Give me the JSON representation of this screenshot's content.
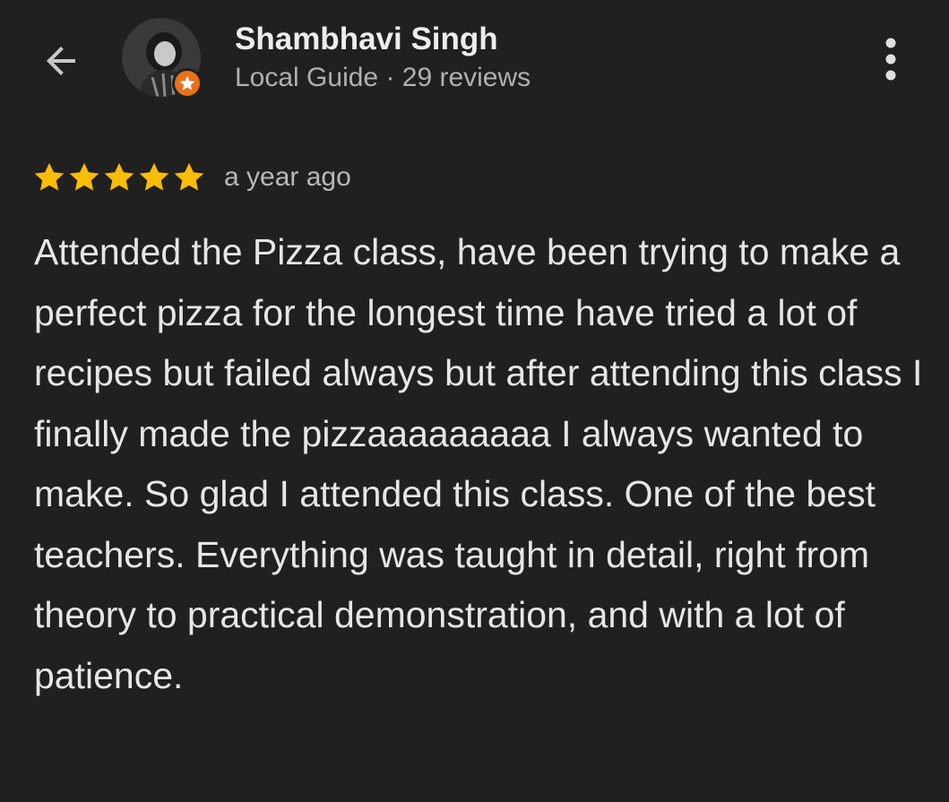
{
  "header": {
    "back_icon": "arrow-left-icon",
    "more_icon": "more-vert-icon"
  },
  "reviewer": {
    "name": "Shambhavi Singh",
    "meta": "Local Guide · 29 reviews",
    "badge_icon": "star-badge-icon",
    "badge_color": "#e8711c"
  },
  "review": {
    "rating": 5,
    "rating_max": 5,
    "star_color": "#fbbc04",
    "date": "a year ago",
    "text": "Attended the Pizza class, have been trying to make a perfect pizza for the longest time have tried a lot of recipes but failed always but after attending this class I finally made the pizzaaaaaaaaa I always wanted to make. So glad I attended this class. One of the best teachers. Everything was taught in detail, right from theory to practical demonstration, and with a lot of patience."
  },
  "colors": {
    "background": "#202020",
    "text_primary": "#ededed",
    "text_secondary": "#b0b0b0"
  }
}
